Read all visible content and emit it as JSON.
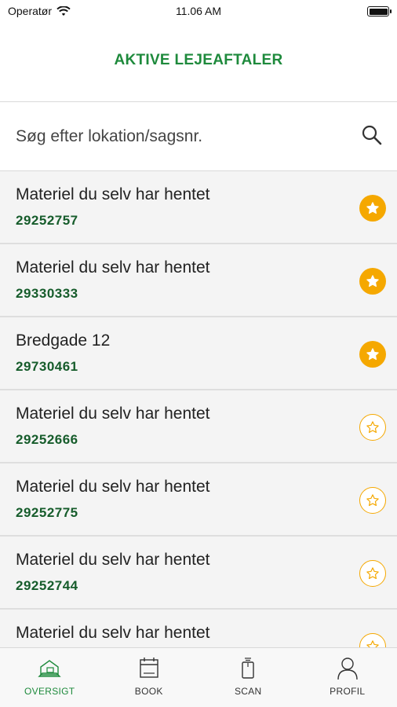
{
  "status_bar": {
    "carrier": "Operatør",
    "time": "11.06 AM"
  },
  "header": {
    "title": "AKTIVE LEJEAFTALER"
  },
  "search": {
    "placeholder": "Søg efter lokation/sagsnr.",
    "value": ""
  },
  "colors": {
    "accent_green": "#1e8a3c",
    "number_green": "#165c2b",
    "star_orange": "#f5a800"
  },
  "agreements": [
    {
      "name": "Materiel du selv har hentet",
      "number": "29252757",
      "favorite": true
    },
    {
      "name": "Materiel du selv har hentet",
      "number": "29330333",
      "favorite": true
    },
    {
      "name": "Bredgade 12",
      "number": "29730461",
      "favorite": true
    },
    {
      "name": "Materiel du selv har hentet",
      "number": "29252666",
      "favorite": false
    },
    {
      "name": "Materiel du selv har hentet",
      "number": "29252775",
      "favorite": false
    },
    {
      "name": "Materiel du selv har hentet",
      "number": "29252744",
      "favorite": false
    },
    {
      "name": "Materiel du selv har hentet",
      "number": "",
      "favorite": false
    }
  ],
  "tabs": [
    {
      "label": "OVERSIGT",
      "icon": "overview-icon",
      "active": true
    },
    {
      "label": "BOOK",
      "icon": "book-icon",
      "active": false
    },
    {
      "label": "SCAN",
      "icon": "scan-icon",
      "active": false
    },
    {
      "label": "PROFIL",
      "icon": "profile-icon",
      "active": false
    }
  ]
}
